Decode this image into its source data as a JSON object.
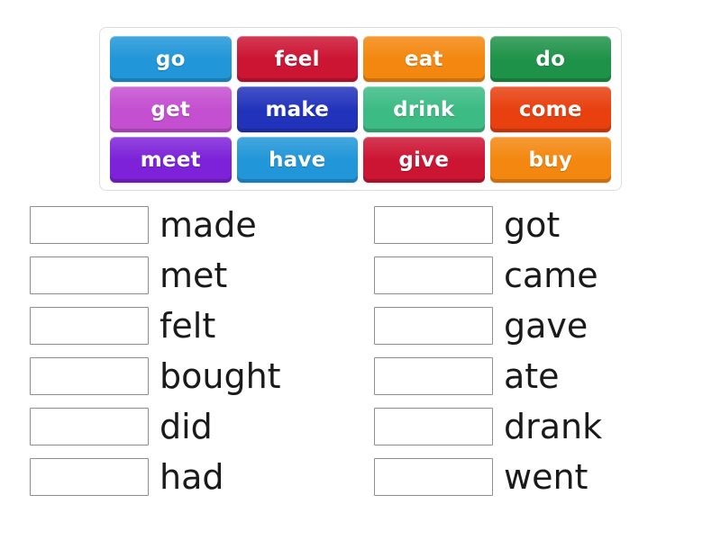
{
  "word_bank": {
    "rows": [
      [
        {
          "label": "go",
          "color": "#2196d8"
        },
        {
          "label": "feel",
          "color": "#cc1433"
        },
        {
          "label": "eat",
          "color": "#f4870f"
        },
        {
          "label": "do",
          "color": "#1f9249"
        }
      ],
      [
        {
          "label": "get",
          "color": "#c44fd0"
        },
        {
          "label": "make",
          "color": "#2233bb"
        },
        {
          "label": "drink",
          "color": "#3cbb85"
        },
        {
          "label": "come",
          "color": "#e8400f"
        }
      ],
      [
        {
          "label": "meet",
          "color": "#7d22d8"
        },
        {
          "label": "have",
          "color": "#2196d8"
        },
        {
          "label": "give",
          "color": "#cc1433"
        },
        {
          "label": "buy",
          "color": "#f4870f"
        }
      ]
    ]
  },
  "answers": {
    "left_column": [
      {
        "drop_value": "",
        "word": "made"
      },
      {
        "drop_value": "",
        "word": "met"
      },
      {
        "drop_value": "",
        "word": "felt"
      },
      {
        "drop_value": "",
        "word": "bought"
      },
      {
        "drop_value": "",
        "word": "did"
      },
      {
        "drop_value": "",
        "word": "had"
      }
    ],
    "right_column": [
      {
        "drop_value": "",
        "word": "got"
      },
      {
        "drop_value": "",
        "word": "came"
      },
      {
        "drop_value": "",
        "word": "gave"
      },
      {
        "drop_value": "",
        "word": "ate"
      },
      {
        "drop_value": "",
        "word": "drank"
      },
      {
        "drop_value": "",
        "word": "went"
      }
    ]
  },
  "colors": {
    "bank_border": "#dddddd",
    "drop_box_border": "#8f8f8f",
    "word_text": "#1a1a1a",
    "tile_text": "#ffffff",
    "page_background": "#ffffff"
  }
}
